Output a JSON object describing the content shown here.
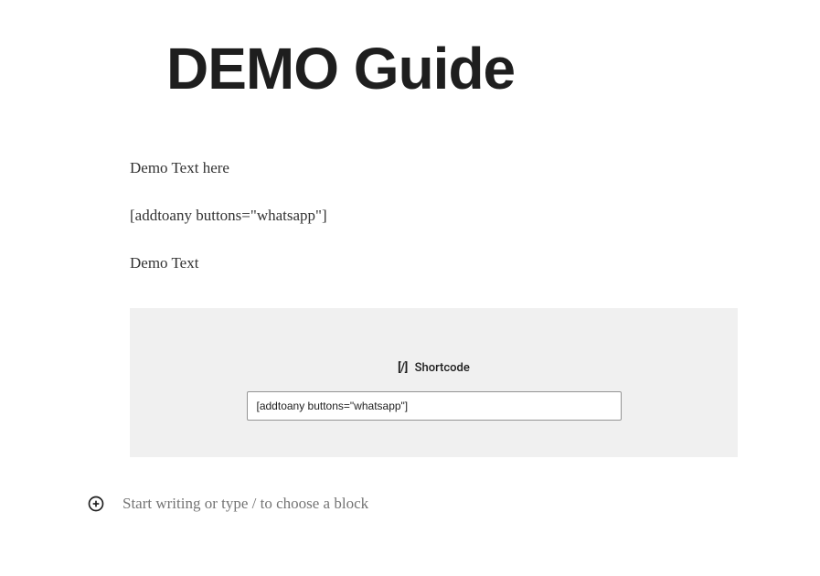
{
  "page": {
    "title": "DEMO Guide"
  },
  "blocks": {
    "paragraph1": "Demo Text here",
    "paragraph2": " [addtoany buttons=\"whatsapp\"]",
    "paragraph3": "Demo Text"
  },
  "shortcode": {
    "label": "Shortcode",
    "value": "[addtoany buttons=\"whatsapp\"]"
  },
  "appender": {
    "placeholder": "Start writing or type / to choose a block"
  }
}
